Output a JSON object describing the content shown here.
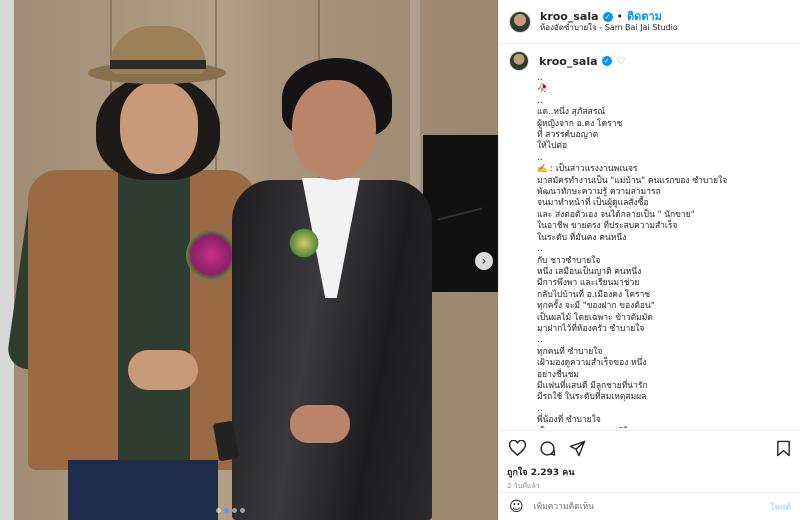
{
  "post": {
    "username": "kroo_sala",
    "follow_label": "ติดตาม",
    "separator": "•",
    "location": "ห้องอัดซำบายใจ - Sam Bai Jai Studio",
    "caption_lines": "..\n🥀\n..\nแด..หนึ่ง สุภัสสรณ์\nผู้หญิงจาก อ.คง โคราช\nที่ สวรรค์บอญาต\nให้ไปต่อ\n..\n✍️ : เป็นสาวแรงงานพเนจร\nมาสมัครทำงานเป็น \"แม่บ้าน\" คนแรกของ ซำบายใจ\nพัฒนาทักษะความรู้ ความสามารถ\nจนมาทำหน้าที่ เป็นผู้ดูแลสั่งซื้อ\nและ ส่งต่อตัวเอง จนได้กลายเป็น \" นักขาย\"\nในอาชีพ ขายตรง ที่ประสบความสำเร็จ\nในระดับ ที่มั่นคง คนหนึ่ง\n..\nกับ ชาวซำบายใจ\nหนึ่ง เสมือนเป็นญาติ คนหนึ่ง\nมีการพึ่งพา และเรียนมาช่วย\nกลับไปบ้านที่ อ.เมืองคง โคราช\nทุกครั้ง จะมี \"ของฝาก ของต้อน\"\nเป็นผลไม้ โดยเฉพาะ ข้าวต้มมัด\nมาฝากไว้ที่ห้องครัว ซำบายใจ\n..\nทุกคนที่ ซำบายใจ\nเฝ้ามองดูความสำเร็จของ หนึ่ง\nอย่างชื่นชม\nมีแฟนที่แสนดี มีลูกชายที่น่ารัก\nมีรถใช้ ในระดับที่สมเหตุสมผล\n..\nพี่น้องที่ ซำบายใจ\nเป็นผลงานและความภูมิใจ"
  },
  "actions": {
    "likes_text": "ถูกใจ 2.293 คน",
    "time_text": "2 วันที่แล้ว"
  },
  "comment": {
    "placeholder": "เพิ่มความคิดเห็น",
    "post_label": "โพสต์"
  },
  "icons": {
    "verified": "verified-badge-icon",
    "heart": "heart-icon",
    "comment": "comment-icon",
    "share": "share-icon",
    "bookmark": "bookmark-icon",
    "emoji": "emoji-icon",
    "carousel_next": "chevron-right-icon"
  },
  "colors": {
    "accent": "#0095f6",
    "text": "#262626",
    "muted": "#8e8e8e"
  },
  "carousel": {
    "slide_count": 4,
    "active_index": 1
  }
}
